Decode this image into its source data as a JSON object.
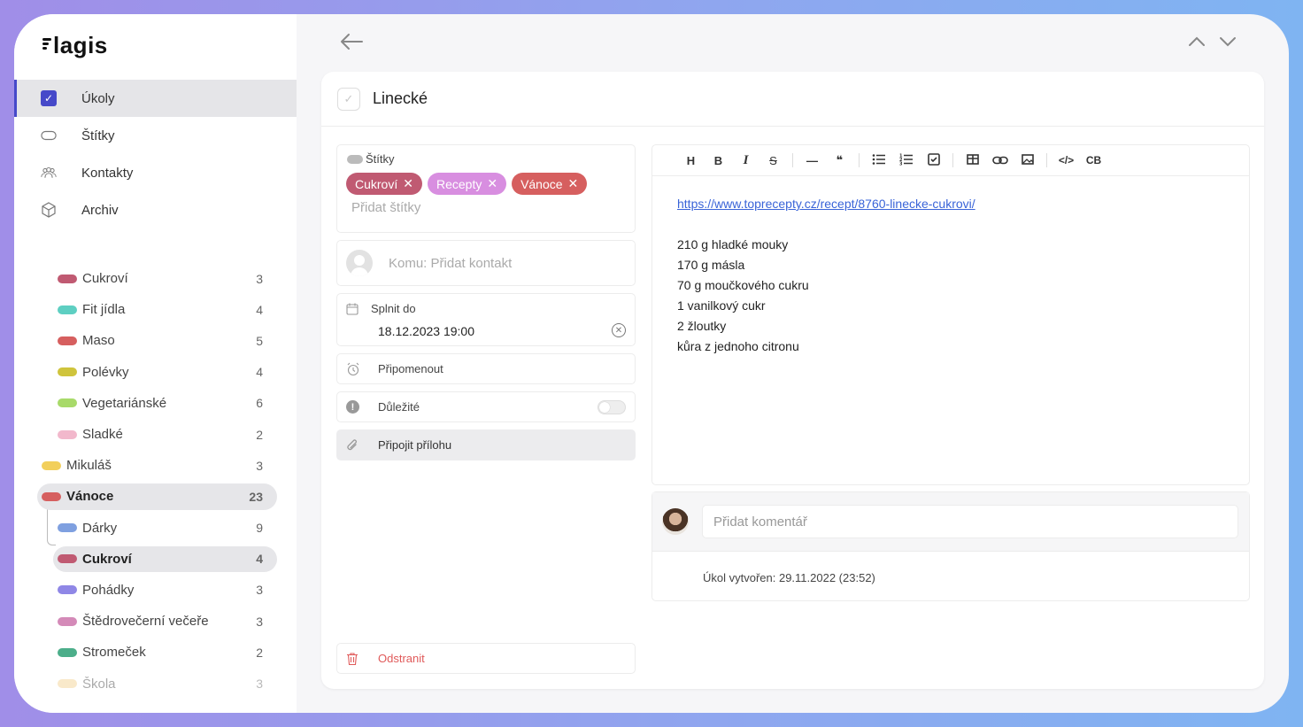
{
  "app": {
    "logo": "lagis"
  },
  "nav": [
    {
      "label": "Úkoly",
      "icon": "checkbox-icon",
      "active": true
    },
    {
      "label": "Štítky",
      "icon": "tag-icon"
    },
    {
      "label": "Kontakty",
      "icon": "contacts-icon"
    },
    {
      "label": "Archiv",
      "icon": "archive-icon"
    }
  ],
  "labels": [
    {
      "name": "Cukroví",
      "count": "3",
      "color": "#c05a72",
      "level": "indent"
    },
    {
      "name": "Fit jídla",
      "count": "4",
      "color": "#5ecfc2",
      "level": "indent"
    },
    {
      "name": "Maso",
      "count": "5",
      "color": "#d65f5f",
      "level": "indent"
    },
    {
      "name": "Polévky",
      "count": "4",
      "color": "#cfc43c",
      "level": "indent"
    },
    {
      "name": "Vegetariánské",
      "count": "6",
      "color": "#a8da6a",
      "level": "indent"
    },
    {
      "name": "Sladké",
      "count": "2",
      "color": "#f2b8cc",
      "level": "indent"
    },
    {
      "name": "Mikuláš",
      "count": "3",
      "color": "#f2cf5b",
      "level": "root"
    },
    {
      "name": "Vánoce",
      "count": "23",
      "color": "#d65f5f",
      "level": "root",
      "selected": true
    },
    {
      "name": "Dárky",
      "count": "9",
      "color": "#7fa0e0",
      "level": "indent"
    },
    {
      "name": "Cukroví",
      "count": "4",
      "color": "#c05a72",
      "level": "indent",
      "selected": true
    },
    {
      "name": "Pohádky",
      "count": "3",
      "color": "#8f87e6",
      "level": "indent"
    },
    {
      "name": "Štědrovečerní večeře",
      "count": "3",
      "color": "#d48ab8",
      "level": "indent"
    },
    {
      "name": "Stromeček",
      "count": "2",
      "color": "#4cae8a",
      "level": "indent"
    },
    {
      "name": "Škola",
      "count": "3",
      "color": "#f2cf8a",
      "level": "indent",
      "faded": true
    }
  ],
  "task": {
    "title": "Linecké",
    "tags_label": "Štítky",
    "tags": [
      {
        "name": "Cukroví",
        "color": "#c05a72"
      },
      {
        "name": "Recepty",
        "color": "#d88ee0"
      },
      {
        "name": "Vánoce",
        "color": "#d65f5f"
      }
    ],
    "add_tags": "Přidat štítky",
    "contact_placeholder": "Komu: Přidat kontakt",
    "due_label": "Splnit do",
    "due_value": "18.12.2023 19:00",
    "remind_label": "Připomenout",
    "important_label": "Důležité",
    "attach_label": "Připojit přílohu",
    "delete_label": "Odstranit"
  },
  "editor": {
    "toolbar": [
      "H",
      "B",
      "I",
      "S",
      "—",
      "❝",
      "list",
      "olist",
      "check",
      "table",
      "link",
      "image",
      "</>",
      "CB"
    ],
    "link": "https://www.toprecepty.cz/recept/8760-linecke-cukrovi/",
    "lines": [
      "210 g hladké mouky",
      "170 g másla",
      "70 g moučkového cukru",
      "1 vanilkový cukr",
      "2 žloutky",
      "kůra z jednoho citronu"
    ]
  },
  "comments": {
    "placeholder": "Přidat komentář",
    "created": "Úkol vytvořen: 29.11.2022 (23:52)"
  }
}
